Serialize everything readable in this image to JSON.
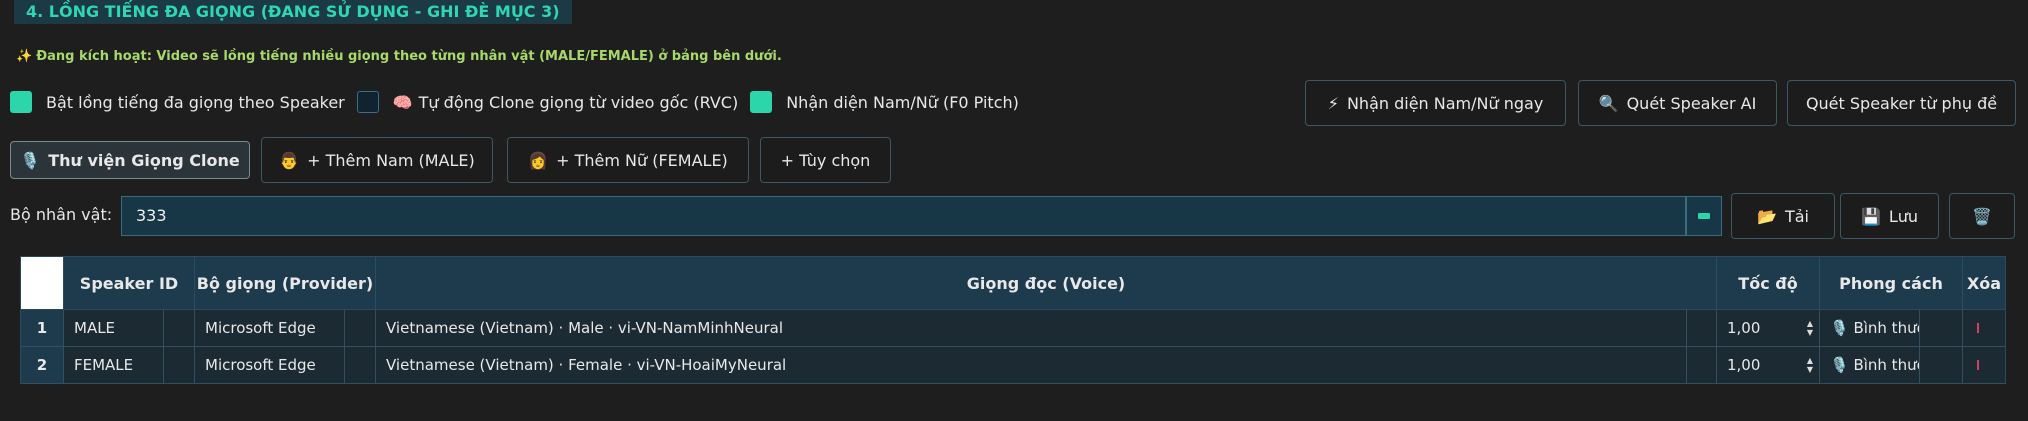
{
  "section": {
    "title": "4. LỒNG TIẾNG ĐA GIỌNG (ĐANG SỬ DỤNG - GHI ĐÈ MỤC 3)",
    "hint_icon": "sparkles-icon",
    "hint": "Đang kích hoạt: Video sẽ lồng tiếng nhiều giọng theo từng nhân vật (MALE/FEMALE) ở bảng bên dưới."
  },
  "options": [
    {
      "label": "Bật lồng tiếng đa giọng theo Speaker",
      "checked": true,
      "emoji": ""
    },
    {
      "label": "Tự động Clone giọng từ video gốc (RVC)",
      "checked": false,
      "emoji": "🧠"
    },
    {
      "label": "Nhận diện Nam/Nữ (F0 Pitch)",
      "checked": true,
      "emoji": ""
    }
  ],
  "actions": {
    "detect_gender": {
      "icon": "⚡",
      "label": "Nhận diện Nam/Nữ ngay"
    },
    "scan_ai": {
      "icon": "🔍",
      "label": "Quét Speaker AI"
    },
    "scan_subs": {
      "label": "Quét Speaker từ phụ đề"
    }
  },
  "toolbar": {
    "clone_library": {
      "icon": "🎙️",
      "label": "Thư viện Giọng Clone"
    },
    "add_male": {
      "icon": "👨",
      "label": "+ Thêm Nam (MALE)"
    },
    "add_female": {
      "icon": "👩",
      "label": "+ Thêm Nữ (FEMALE)"
    },
    "custom": {
      "label": "+ Tùy chọn"
    }
  },
  "character_set": {
    "label": "Bộ nhân vật:",
    "value": "333",
    "load": {
      "icon": "📂",
      "label": "Tải"
    },
    "save": {
      "icon": "💾",
      "label": "Lưu"
    },
    "delete_icon": "🗑️"
  },
  "table": {
    "headers": {
      "speaker_id": "Speaker ID",
      "provider": "Bộ giọng (Provider)",
      "voice": "Giọng đọc (Voice)",
      "speed": "Tốc độ",
      "style": "Phong cách",
      "delete": "Xóa"
    },
    "rows": [
      {
        "index": "1",
        "speaker_id": "MALE",
        "provider": "Microsoft Edge",
        "voice": "Vietnamese (Vietnam) · Male · vi-VN-NamMinhNeural",
        "speed": "1,00",
        "style": "🎙️ Bình thường"
      },
      {
        "index": "2",
        "speaker_id": "FEMALE",
        "provider": "Microsoft Edge",
        "voice": "Vietnamese (Vietnam) · Female · vi-VN-HoaiMyNeural",
        "speed": "1,00",
        "style": "🎙️ Bình thường"
      }
    ]
  },
  "colors": {
    "accent": "#2bd6aa",
    "title": "#2fd6b4",
    "hint": "#a8d86a"
  }
}
